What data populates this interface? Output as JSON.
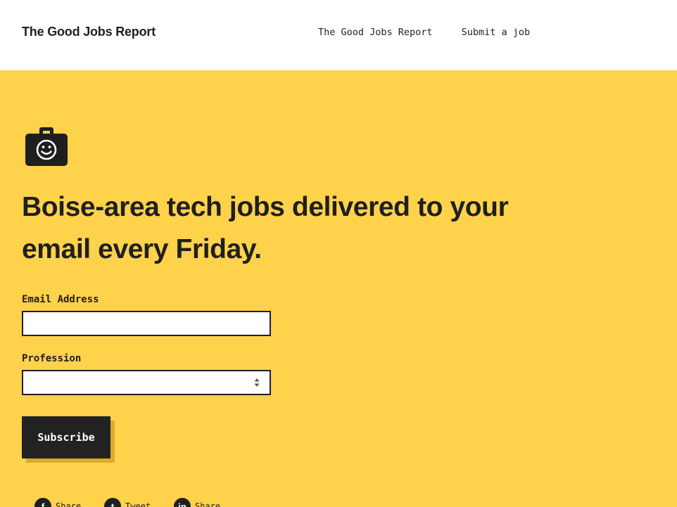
{
  "header": {
    "brand": "The Good Jobs Report",
    "nav": [
      {
        "label": "The Good Jobs Report"
      },
      {
        "label": "Submit a job"
      }
    ]
  },
  "hero": {
    "icon": "smiling-briefcase-icon",
    "headline": "Boise-area tech jobs delivered to your email every Friday.",
    "form": {
      "email_label": "Email Address",
      "email_value": "",
      "profession_label": "Profession",
      "profession_value": "",
      "subscribe_label": "Subscribe"
    },
    "share": [
      {
        "icon": "facebook-icon",
        "glyph": "f",
        "label": "Share"
      },
      {
        "icon": "twitter-icon",
        "glyph": "t",
        "label": "Tweet"
      },
      {
        "icon": "linkedin-icon",
        "glyph": "in",
        "label": "Share"
      }
    ]
  },
  "colors": {
    "background": "#ffd24c",
    "header": "#ffffff",
    "text": "#1f1f1f",
    "button": "#222222",
    "button_shadow": "#d9ab2e"
  }
}
